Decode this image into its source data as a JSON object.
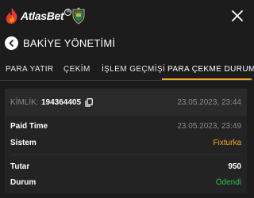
{
  "header": {
    "brand": "AtlasBet",
    "brand_badge": "®",
    "close_icon": "close-icon"
  },
  "titlebar": {
    "title": "BAKİYE YÖNETİMİ"
  },
  "tabs": [
    {
      "label": "PARA YATIR",
      "active": false
    },
    {
      "label": "ÇEKİM",
      "active": false
    },
    {
      "label": "İŞLEM GEÇMİŞİ",
      "active": false
    },
    {
      "label": "PARA ÇEKME DURUMU",
      "active": true
    }
  ],
  "colors": {
    "accent": "#f5a623",
    "success": "#27c24c",
    "background": "#1c1c1c",
    "card": "#232323",
    "muted": "#8a8a8a"
  },
  "withdrawal": {
    "id_label": "KİMLİK:",
    "id_value": "194364405",
    "created_at": "23.05.2023, 23:44",
    "paid_time_label": "Paid Time",
    "paid_time_value": "23.05.2023, 23:49",
    "system_label": "Sistem",
    "system_value": "Fixturka",
    "amount_label": "Tutar",
    "amount_value": "950",
    "status_label": "Durum",
    "status_value": "Ödendi"
  }
}
